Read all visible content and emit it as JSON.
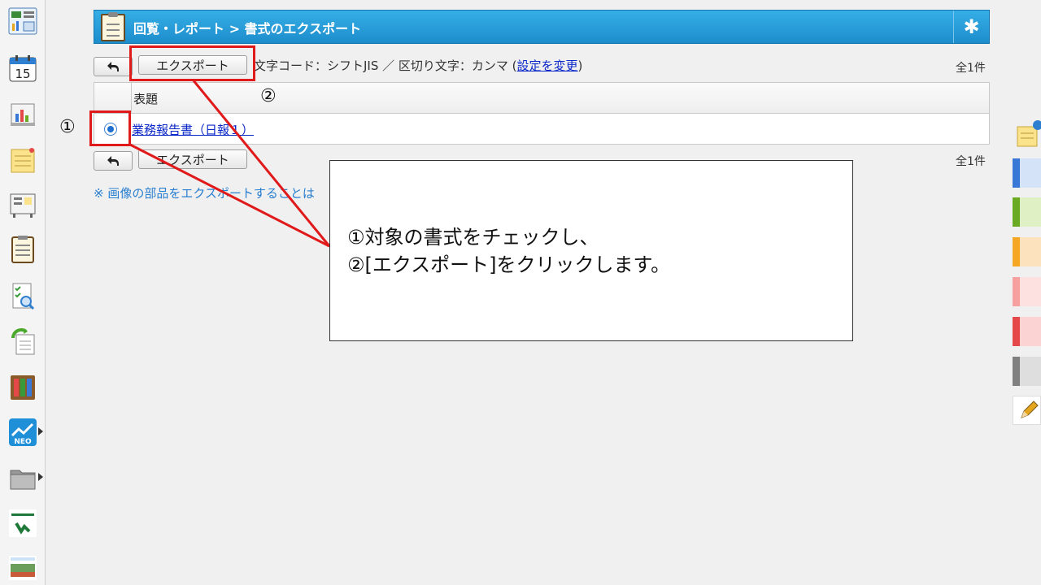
{
  "header": {
    "title": "回覧・レポート > 書式のエクスポート",
    "settings_icon": "gear-icon"
  },
  "toolbar": {
    "back_icon": "back-arrow-icon",
    "export_label": "エクスポート",
    "info_prefix": "文字コード：シフトJIS ／ 区切り文字：カンマ (",
    "change_settings_link": "設定を変更",
    "info_suffix": ")",
    "count": "全1件"
  },
  "table": {
    "column_title": "表題",
    "rows": [
      {
        "title": "業務報告書（日報１）",
        "selected": true
      }
    ]
  },
  "bottom_toolbar": {
    "export_label": "エクスポート",
    "count": "全1件"
  },
  "note": "※ 画像の部品をエクスポートすることは",
  "annotation": {
    "marker_1": "①",
    "marker_2": "②",
    "line_1": "①対象の書式をチェックし、",
    "line_2": "②[エクスポート]をクリックします。",
    "color": "#e0191a"
  },
  "sidebar": {
    "apps": [
      "portal-icon",
      "schedule-icon",
      "timecard-icon",
      "memo-icon",
      "bulletin-icon",
      "report-icon",
      "survey-icon",
      "workflow-icon",
      "address-book-icon",
      "neo-icon",
      "folder-icon",
      "tenomo-icon",
      "news-icon"
    ],
    "calendar_day": "15",
    "neo_label": "NEO"
  },
  "palette": {
    "colors": [
      {
        "dark": "#3a78d8",
        "light": "#d5e3f8"
      },
      {
        "dark": "#6aaa22",
        "light": "#def0c4"
      },
      {
        "dark": "#f5a623",
        "light": "#fde3bd"
      },
      {
        "dark": "#f7a0a0",
        "light": "#fde1e1"
      },
      {
        "dark": "#e54848",
        "light": "#fbd3d3"
      },
      {
        "dark": "#808080",
        "light": "#dedede"
      }
    ]
  }
}
